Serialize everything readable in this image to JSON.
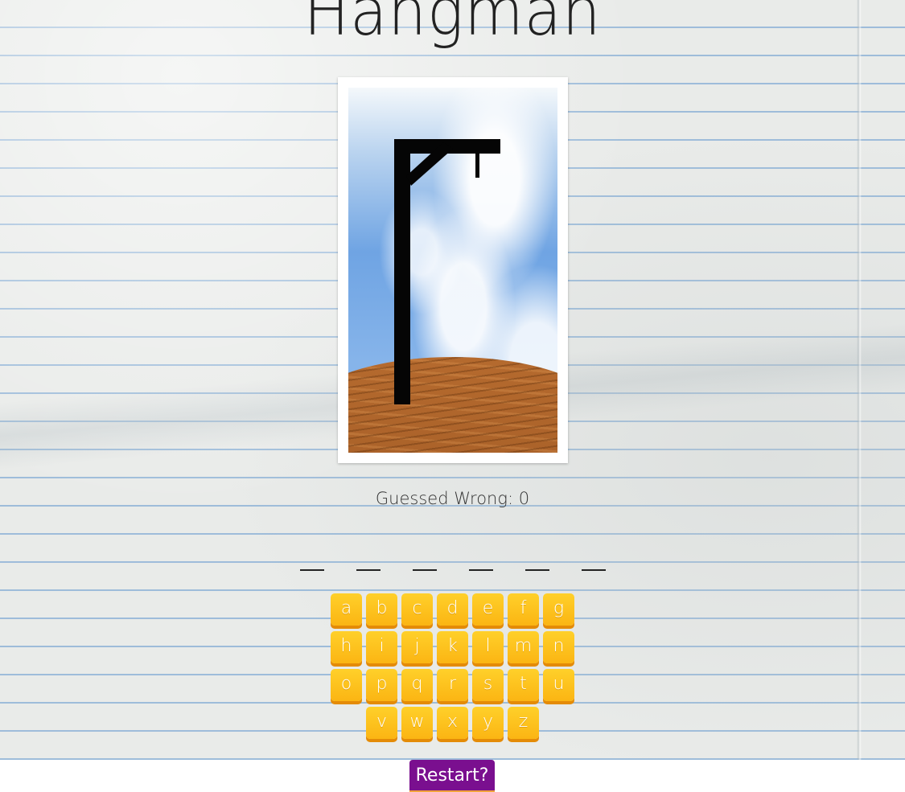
{
  "title": "Hangman",
  "status": {
    "wrong_label": "Guessed Wrong:",
    "wrong_count": "0"
  },
  "word": {
    "blanks": [
      "",
      "",
      "",
      "",
      "",
      ""
    ]
  },
  "keyboard": {
    "rows": [
      [
        "a",
        "b",
        "c",
        "d",
        "e",
        "f",
        "g"
      ],
      [
        "h",
        "i",
        "j",
        "k",
        "l",
        "m",
        "n"
      ],
      [
        "o",
        "p",
        "q",
        "r",
        "s",
        "t",
        "u"
      ],
      [
        "v",
        "w",
        "x",
        "y",
        "z"
      ]
    ]
  },
  "restart_label": "Restart?",
  "colors": {
    "key": "#fbb513",
    "key_shadow": "#e48b07",
    "restart": "#7a0f8f"
  }
}
